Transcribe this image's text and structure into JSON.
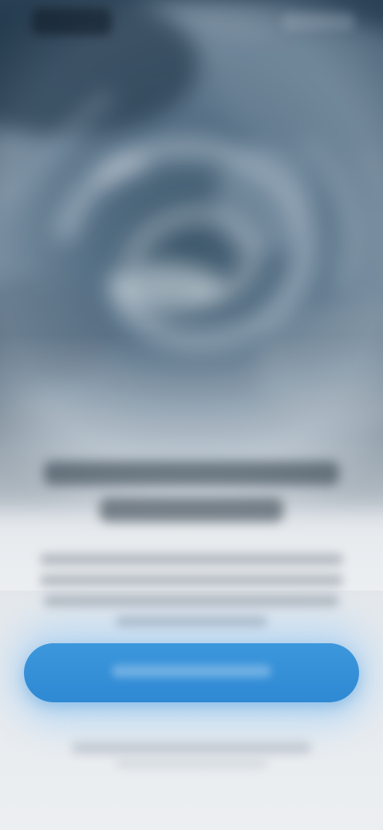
{
  "status_bar": {
    "time": ""
  },
  "hero": {
    "image_icon": "storm-cloud-image"
  },
  "onboarding": {
    "title": "",
    "description": ""
  },
  "actions": {
    "primary_label": "",
    "secondary_label": ""
  },
  "colors": {
    "accent": "#3d97dc",
    "background": "#eceff2",
    "hero_dark": "#2c4357"
  }
}
